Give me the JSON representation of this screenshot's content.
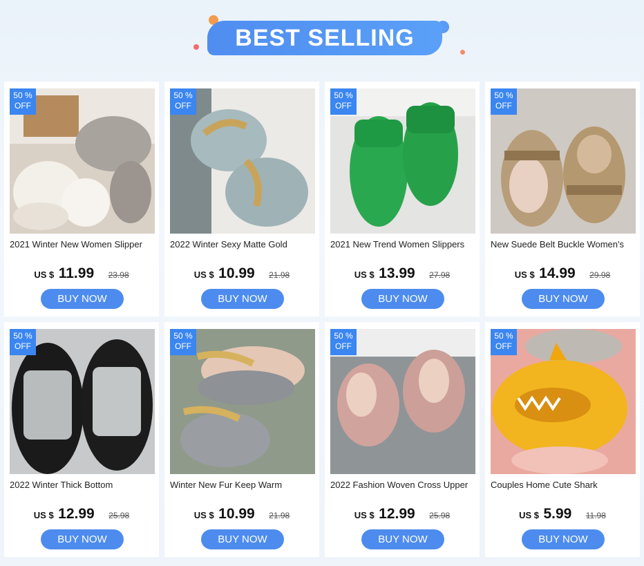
{
  "header": {
    "title": "BEST SELLING"
  },
  "colors": {
    "accent": "#4d8cee",
    "badge": "#3b86f0",
    "background": "#eaf2fa"
  },
  "currency_label": "US $",
  "button_label": "BUY NOW",
  "badge": {
    "line1": "50 %",
    "line2": "OFF"
  },
  "products": [
    {
      "name": "2021 Winter New Women Slipper",
      "price": "11.99",
      "old_price": "23.98",
      "image": "cream-gray-fur-slippers"
    },
    {
      "name": "2022 Winter Sexy  Matte Gold",
      "price": "10.99",
      "old_price": "21.98",
      "image": "gray-fur-gold-chain-slides"
    },
    {
      "name": "2021 New Trend Women Slippers",
      "price": "13.99",
      "old_price": "27.98",
      "image": "green-terry-slides"
    },
    {
      "name": "New Suede Belt Buckle Women's",
      "price": "14.99",
      "old_price": "29.98",
      "image": "tan-suede-buckle-sandals"
    },
    {
      "name": "2022 Winter Thick Bottom",
      "price": "12.99",
      "old_price": "25.98",
      "image": "silver-padded-slippers"
    },
    {
      "name": "Winter New Fur Keep Warm",
      "price": "10.99",
      "old_price": "21.98",
      "image": "gray-fur-chain-slides"
    },
    {
      "name": "2022 Fashion Woven Cross Upper",
      "price": "12.99",
      "old_price": "25.98",
      "image": "pink-cross-fur-slippers"
    },
    {
      "name": "Couples Home Cute Shark",
      "price": "5.99",
      "old_price": "11.98",
      "image": "yellow-shark-slippers"
    }
  ]
}
